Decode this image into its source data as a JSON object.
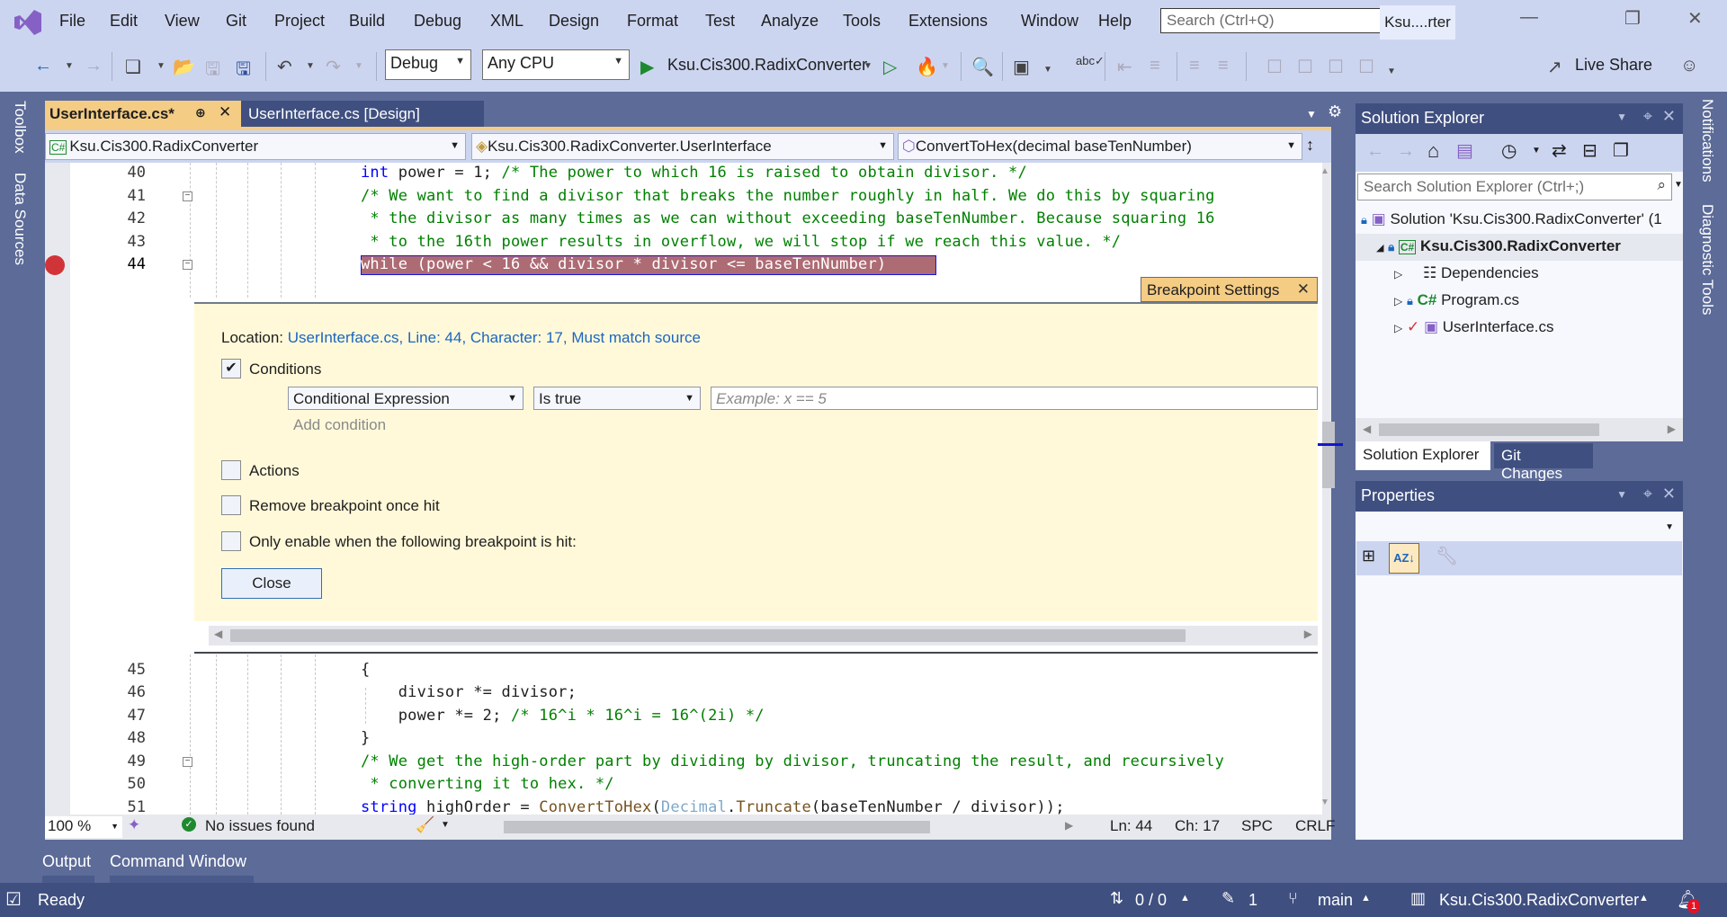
{
  "menu": [
    "File",
    "Edit",
    "View",
    "Git",
    "Project",
    "Build",
    "Debug",
    "XML",
    "Design",
    "Format",
    "Test",
    "Analyze",
    "Tools",
    "Extensions",
    "Window",
    "Help"
  ],
  "search": {
    "placeholder": "Search (Ctrl+Q)"
  },
  "title_tag": "Ksu....rter",
  "toolbar": {
    "config": "Debug",
    "platform": "Any CPU",
    "start_target": "Ksu.Cis300.RadixConverter",
    "live_share": "Live Share"
  },
  "left_dock": [
    "Toolbox",
    "Data Sources"
  ],
  "right_dock": [
    "Notifications",
    "Diagnostic Tools"
  ],
  "doc_tabs": [
    {
      "label": "UserInterface.cs*",
      "active": true
    },
    {
      "label": "UserInterface.cs [Design]",
      "active": false
    }
  ],
  "nav": {
    "project": "Ksu.Cis300.RadixConverter",
    "type": "Ksu.Cis300.RadixConverter.UserInterface",
    "member": "ConvertToHex(decimal baseTenNumber)"
  },
  "code_top": [
    {
      "n": "40",
      "text": "int power = 1; /* The power to which 16 is raised to obtain divisor. */"
    },
    {
      "n": "41",
      "text": "/* We want to find a divisor that breaks the number roughly in half. We do this by squaring"
    },
    {
      "n": "42",
      "text": " * the divisor as many times as we can without exceeding baseTenNumber. Because squaring 16"
    },
    {
      "n": "43",
      "text": " * to the 16th power results in overflow, we will stop if we reach this value. */"
    },
    {
      "n": "44",
      "text": "while (power < 16 && divisor * divisor <= baseTenNumber)"
    }
  ],
  "code_bottom": [
    {
      "n": "45",
      "text": "{"
    },
    {
      "n": "46",
      "text": "    divisor *= divisor;"
    },
    {
      "n": "47",
      "text": "    power *= 2; /* 16^i * 16^i = 16^(2i) */"
    },
    {
      "n": "48",
      "text": "}"
    },
    {
      "n": "49",
      "text": "/* We get the high-order part by dividing by divisor, truncating the result, and recursively"
    },
    {
      "n": "50",
      "text": " * converting it to hex. */"
    },
    {
      "n": "51",
      "text": "string highOrder = ConvertToHex(Decimal.Truncate(baseTenNumber / divisor));"
    }
  ],
  "breakpoint": {
    "title": "Breakpoint Settings",
    "location_label": "Location:",
    "location_value": "UserInterface.cs, Line: 44, Character: 17, Must match source",
    "conditions_label": "Conditions",
    "conditions_checked": true,
    "condition_type": "Conditional Expression",
    "condition_mode": "Is true",
    "condition_placeholder": "Example: x == 5",
    "add_condition": "Add condition",
    "actions_label": "Actions",
    "remove_once_hit_label": "Remove breakpoint once hit",
    "only_enable_label": "Only enable when the following breakpoint is hit:",
    "close_label": "Close"
  },
  "editor_status": {
    "zoom": "100 %",
    "issues": "No issues found",
    "line": "Ln: 44",
    "char": "Ch: 17",
    "whitespace": "SPC",
    "line_ending": "CRLF"
  },
  "solution_explorer": {
    "title": "Solution Explorer",
    "search_placeholder": "Search Solution Explorer (Ctrl+;)",
    "tree": [
      {
        "label": "Solution 'Ksu.Cis300.RadixConverter' (1"
      },
      {
        "label": "Ksu.Cis300.RadixConverter"
      },
      {
        "label": "Dependencies"
      },
      {
        "label": "Program.cs"
      },
      {
        "label": "UserInterface.cs"
      }
    ],
    "tabs": [
      "Solution Explorer",
      "Git Changes"
    ]
  },
  "properties": {
    "title": "Properties"
  },
  "bottom_tabs": [
    "Output",
    "Command Window"
  ],
  "status": {
    "ready": "Ready",
    "sync": "0 / 0",
    "changes": "1",
    "branch": "main",
    "repo": "Ksu.Cis300.RadixConverter",
    "notifications": "1"
  }
}
